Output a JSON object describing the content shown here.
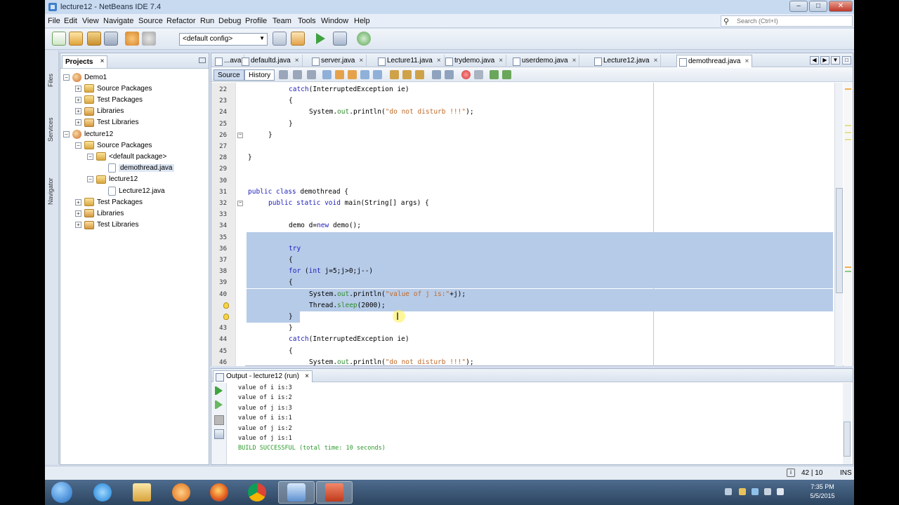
{
  "window": {
    "title": "lecture12 - NetBeans IDE 7.4",
    "controls": {
      "minimize": "–",
      "maximize": "□",
      "close": "✕"
    }
  },
  "menu": [
    "File",
    "Edit",
    "View",
    "Navigate",
    "Source",
    "Refactor",
    "Run",
    "Debug",
    "Profile",
    "Team",
    "Tools",
    "Window",
    "Help"
  ],
  "search": {
    "placeholder": "Search (Ctrl+I)"
  },
  "toolbar": {
    "config": "<default config>"
  },
  "left_strip": {
    "tabs": [
      "Files",
      "Services",
      "Navigator"
    ]
  },
  "projects": {
    "tab_label": "Projects",
    "close": "×",
    "tree": [
      {
        "label": "Demo1",
        "kind": "proj",
        "depth": 0,
        "toggle": "−"
      },
      {
        "label": "Source Packages",
        "kind": "pkg",
        "depth": 1,
        "toggle": "+"
      },
      {
        "label": "Test Packages",
        "kind": "pkg",
        "depth": 1,
        "toggle": "+"
      },
      {
        "label": "Libraries",
        "kind": "lib",
        "depth": 1,
        "toggle": "+"
      },
      {
        "label": "Test Libraries",
        "kind": "lib",
        "depth": 1,
        "toggle": "+"
      },
      {
        "label": "lecture12",
        "kind": "proj",
        "depth": 0,
        "toggle": "−"
      },
      {
        "label": "Source Packages",
        "kind": "pkg",
        "depth": 1,
        "toggle": "−"
      },
      {
        "label": "<default package>",
        "kind": "pkg",
        "depth": 2,
        "toggle": "−"
      },
      {
        "label": "demothread.java",
        "kind": "file",
        "depth": 3,
        "toggle": "",
        "selected": true
      },
      {
        "label": "lecture12",
        "kind": "pkg",
        "depth": 2,
        "toggle": "−"
      },
      {
        "label": "Lecture12.java",
        "kind": "file",
        "depth": 3,
        "toggle": ""
      },
      {
        "label": "Test Packages",
        "kind": "pkg",
        "depth": 1,
        "toggle": "+"
      },
      {
        "label": "Libraries",
        "kind": "lib",
        "depth": 1,
        "toggle": "+"
      },
      {
        "label": "Test Libraries",
        "kind": "lib",
        "depth": 1,
        "toggle": "+"
      }
    ]
  },
  "editor": {
    "tabs": [
      {
        "label": "...ava",
        "active": false
      },
      {
        "label": "defaultd.java",
        "active": false
      },
      {
        "label": "server.java",
        "active": false
      },
      {
        "label": "Lecture11.java",
        "active": false
      },
      {
        "label": "trydemo.java",
        "active": false
      },
      {
        "label": "userdemo.java",
        "active": false
      },
      {
        "label": "Lecture12.java",
        "active": false
      },
      {
        "label": "demothread.java",
        "active": true
      }
    ],
    "source_label": "Source",
    "history_label": "History",
    "lines": [
      {
        "n": "22",
        "indent": 8,
        "parts": [
          [
            "kw",
            "catch"
          ],
          [
            "",
            "(InterruptedException ie)"
          ]
        ]
      },
      {
        "n": "23",
        "indent": 8,
        "parts": [
          [
            "",
            "{"
          ]
        ]
      },
      {
        "n": "24",
        "indent": 12,
        "parts": [
          [
            "",
            "System."
          ],
          [
            "fld",
            "out"
          ],
          [
            "",
            ".println("
          ],
          [
            "str",
            "\"do not disturb !!!\""
          ],
          [
            "",
            ");"
          ]
        ]
      },
      {
        "n": "25",
        "indent": 8,
        "parts": [
          [
            "",
            "}"
          ]
        ]
      },
      {
        "n": "26",
        "indent": 4,
        "parts": [
          [
            "",
            "}"
          ]
        ]
      },
      {
        "n": "27",
        "indent": 0,
        "parts": []
      },
      {
        "n": "28",
        "indent": 0,
        "parts": [
          [
            "",
            "}"
          ]
        ]
      },
      {
        "n": "29",
        "indent": 0,
        "parts": []
      },
      {
        "n": "30",
        "indent": 0,
        "parts": []
      },
      {
        "n": "31",
        "indent": 0,
        "parts": [
          [
            "kw",
            "public class"
          ],
          [
            "",
            " demothread {"
          ]
        ]
      },
      {
        "n": "32",
        "indent": 4,
        "parts": [
          [
            "kw",
            "public static void"
          ],
          [
            "",
            " main(String[] args) {"
          ]
        ]
      },
      {
        "n": "33",
        "indent": 0,
        "parts": []
      },
      {
        "n": "34",
        "indent": 8,
        "parts": [
          [
            "",
            "demo d="
          ],
          [
            "kw",
            "new"
          ],
          [
            "",
            " demo();"
          ]
        ]
      },
      {
        "n": "35",
        "indent": 0,
        "parts": [],
        "hl": true
      },
      {
        "n": "36",
        "indent": 8,
        "parts": [
          [
            "kw",
            "try"
          ]
        ],
        "hl": true
      },
      {
        "n": "37",
        "indent": 8,
        "parts": [
          [
            "",
            "{"
          ]
        ],
        "hl": true
      },
      {
        "n": "38",
        "indent": 8,
        "parts": [
          [
            "kw",
            "for"
          ],
          [
            "",
            " ("
          ],
          [
            "kw",
            "int"
          ],
          [
            "",
            " j=5;j>0;j--)"
          ]
        ],
        "hl": true
      },
      {
        "n": "39",
        "indent": 8,
        "parts": [
          [
            "",
            "{"
          ]
        ],
        "hl": true
      },
      {
        "n": "40",
        "indent": 12,
        "parts": [
          [
            "",
            "System."
          ],
          [
            "fld",
            "out"
          ],
          [
            "",
            ".println("
          ],
          [
            "str",
            "\"value of j is:\""
          ],
          [
            "",
            "+j);"
          ]
        ],
        "hl": true
      },
      {
        "n": "",
        "indent": 12,
        "parts": [
          [
            "",
            "Thread."
          ],
          [
            "fld",
            "sleep"
          ],
          [
            "",
            "(2000);"
          ]
        ],
        "hl": true,
        "bulb": true
      },
      {
        "n": "",
        "indent": 8,
        "parts": [
          [
            "",
            "}"
          ]
        ],
        "hl": "partial",
        "bulb": true
      },
      {
        "n": "43",
        "indent": 8,
        "parts": [
          [
            "",
            "}"
          ]
        ]
      },
      {
        "n": "44",
        "indent": 8,
        "parts": [
          [
            "kw",
            "catch"
          ],
          [
            "",
            "(InterruptedException ie)"
          ]
        ]
      },
      {
        "n": "45",
        "indent": 8,
        "parts": [
          [
            "",
            "{"
          ]
        ]
      },
      {
        "n": "46",
        "indent": 12,
        "parts": [
          [
            "",
            "System."
          ],
          [
            "fld",
            "out"
          ],
          [
            "",
            ".println("
          ],
          [
            "str",
            "\"do not disturb !!!\""
          ],
          [
            "",
            ");"
          ]
        ]
      }
    ]
  },
  "output": {
    "tab_label": "Output - lecture12 (run)",
    "close": "×",
    "lines": [
      {
        "text": "value of i is:3",
        "ok": false
      },
      {
        "text": "value of i is:2",
        "ok": false
      },
      {
        "text": "value of j is:3",
        "ok": false
      },
      {
        "text": "value of i is:1",
        "ok": false
      },
      {
        "text": "value of j is:2",
        "ok": false
      },
      {
        "text": "value of j is:1",
        "ok": false
      },
      {
        "text": "BUILD SUCCESSFUL (total time: 10 seconds)",
        "ok": true
      }
    ]
  },
  "status": {
    "position": "42 | 10",
    "mode": "INS"
  },
  "taskbar": {
    "clock_time": "7:35 PM",
    "clock_date": "5/5/2015",
    "apps": [
      "start-orb",
      "internet-explorer",
      "file-explorer",
      "media-player",
      "firefox",
      "chrome",
      "netbeans",
      "powerpoint"
    ]
  }
}
